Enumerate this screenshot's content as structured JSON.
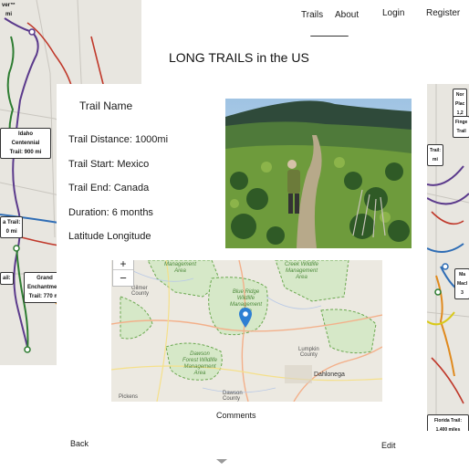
{
  "nav": {
    "trails": "Trails",
    "about": "About",
    "login": "Login",
    "register": "Register"
  },
  "page_title": "LONG TRAILS in the US",
  "trail": {
    "name": "Trail Name",
    "distance": "Trail Distance: 1000mi",
    "start": "Trail Start: Mexico",
    "end": "Trail End: Canada",
    "duration": "Duration: 6 months",
    "lat_long": "Latitude Longitude"
  },
  "buttons": {
    "comments": "Comments",
    "back": "Back",
    "edit": "Edit"
  },
  "map": {
    "zoom_in": "+",
    "zoom_out": "−",
    "labels": {
      "wildlife_top": "Management\nArea",
      "creek": "Creek Wildlife\nManagement\nArea",
      "blue_ridge": "Blue Ridge\nWildlife\nManagement\nArea",
      "dawson": "Dawson\nForest Wildlife\nManagement\nArea",
      "lumpkin": "Lumpkin\nCounty",
      "dahlonega": "Dahlonega",
      "gilmer": "Gilmer\nCounty",
      "pickens": "Pickens",
      "dawson_county": "Dawson\nCounty"
    }
  },
  "background_trails": {
    "left_top_cut": "ver™\nmi",
    "idaho": "Idaho\nCentennial\nTrail: 900 mi",
    "oregon_cut": "a Trail:\n0 mi",
    "il_cut": "ail:",
    "grand": "Grand\nEnchantment\nTrail: 770 mi",
    "right_1": "Nor\nPlac\n1,2",
    "right_2": "Finge\nTrail",
    "right_3": "Trail:\nmi",
    "right_4": "Ma\nMacl\n3",
    "florida": "Florida Trail:\n1,400 miles"
  },
  "colors": {
    "trail_purple": "#5b3a8c",
    "trail_green": "#2e7d32",
    "trail_red": "#c0392b",
    "trail_blue": "#2f6db5",
    "trail_orange": "#e08a1e",
    "map_pin": "#2d7fd3"
  }
}
